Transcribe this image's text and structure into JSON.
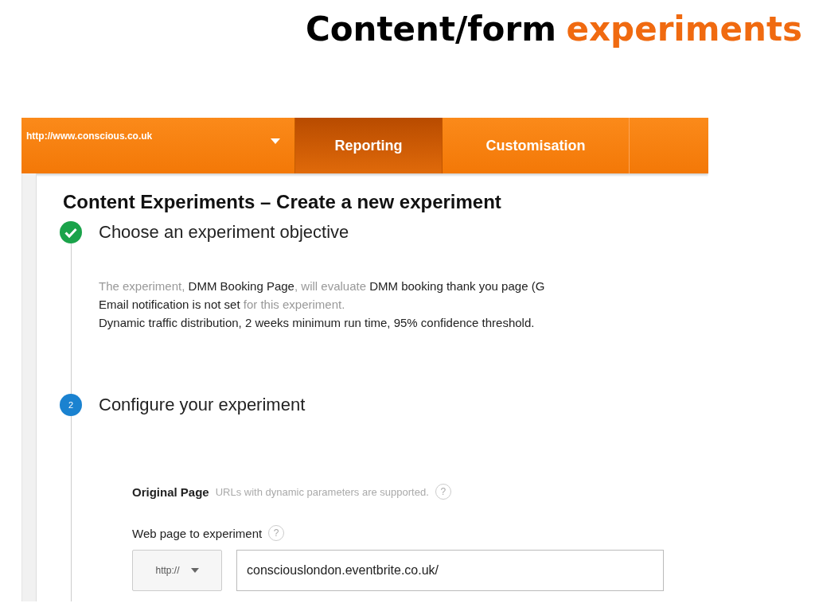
{
  "slide_title": [
    {
      "text": "Content/form",
      "kind": "plain"
    },
    {
      "text": "experiments",
      "kind": "accent"
    }
  ],
  "nav": {
    "property": "http://www.conscious.co.uk",
    "tabs": [
      {
        "label": "Reporting",
        "selected": true
      },
      {
        "label": "Customisation",
        "selected": false
      }
    ]
  },
  "heading": "Content Experiments – Create a new experiment",
  "steps": [
    {
      "kind": "done",
      "title": "Choose an experiment objective",
      "summary": [
        [
          {
            "text": "The experiment, ",
            "strong": false
          },
          {
            "text": "DMM Booking Page",
            "strong": true
          },
          {
            "text": ", will evaluate ",
            "strong": false
          },
          {
            "text": "DMM booking thank you page (G",
            "strong": true
          }
        ],
        [
          {
            "text": "Email notification is not set",
            "strong": true
          },
          {
            "text": " for this experiment.",
            "strong": false
          }
        ],
        [
          {
            "text": "Dynamic traffic distribution, 2 weeks minimum run time, 95% confidence threshold.",
            "strong": true
          }
        ]
      ]
    },
    {
      "kind": "number",
      "number": "2",
      "title": "Configure your experiment"
    }
  ],
  "form": {
    "section_label": "Original Page",
    "section_hint": "URLs with dynamic parameters are supported.",
    "section_help": "?",
    "field_label": "Web page to experiment",
    "field_help": "?",
    "protocol": "http://",
    "url": "consciouslondon.eventbrite.co.uk/"
  }
}
